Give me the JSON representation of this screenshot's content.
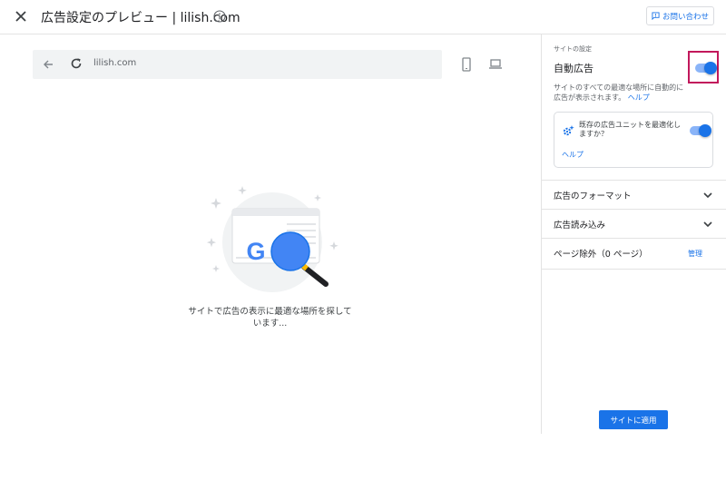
{
  "header": {
    "title": "広告設定のプレビュー | lilish.com",
    "contact_label": "お問い合わせ"
  },
  "preview": {
    "url": "lilish.com",
    "loading_text": "サイトで広告の表示に最適な場所を探しています..."
  },
  "panel": {
    "section_label": "サイトの設定",
    "auto_ads": {
      "title": "自動広告",
      "enabled": true,
      "description": "サイトのすべての最適な場所に自動的に広告が表示されます。",
      "help_link": "ヘルプ"
    },
    "optimize_card": {
      "text": "既存の広告ユニットを最適化しますか？",
      "enabled": true,
      "help_link": "ヘルプ"
    },
    "rows": [
      {
        "label": "広告のフォーマット",
        "icon": "chevron-down-icon"
      },
      {
        "label": "広告読み込み",
        "icon": "chevron-down-icon"
      },
      {
        "label": "ページ除外（0 ページ）",
        "action": "管理"
      }
    ],
    "apply_button": "サイトに適用"
  },
  "colors": {
    "accent": "#1a73e8",
    "highlight": "#c2185b",
    "urlbar": "#f1f3f4"
  }
}
